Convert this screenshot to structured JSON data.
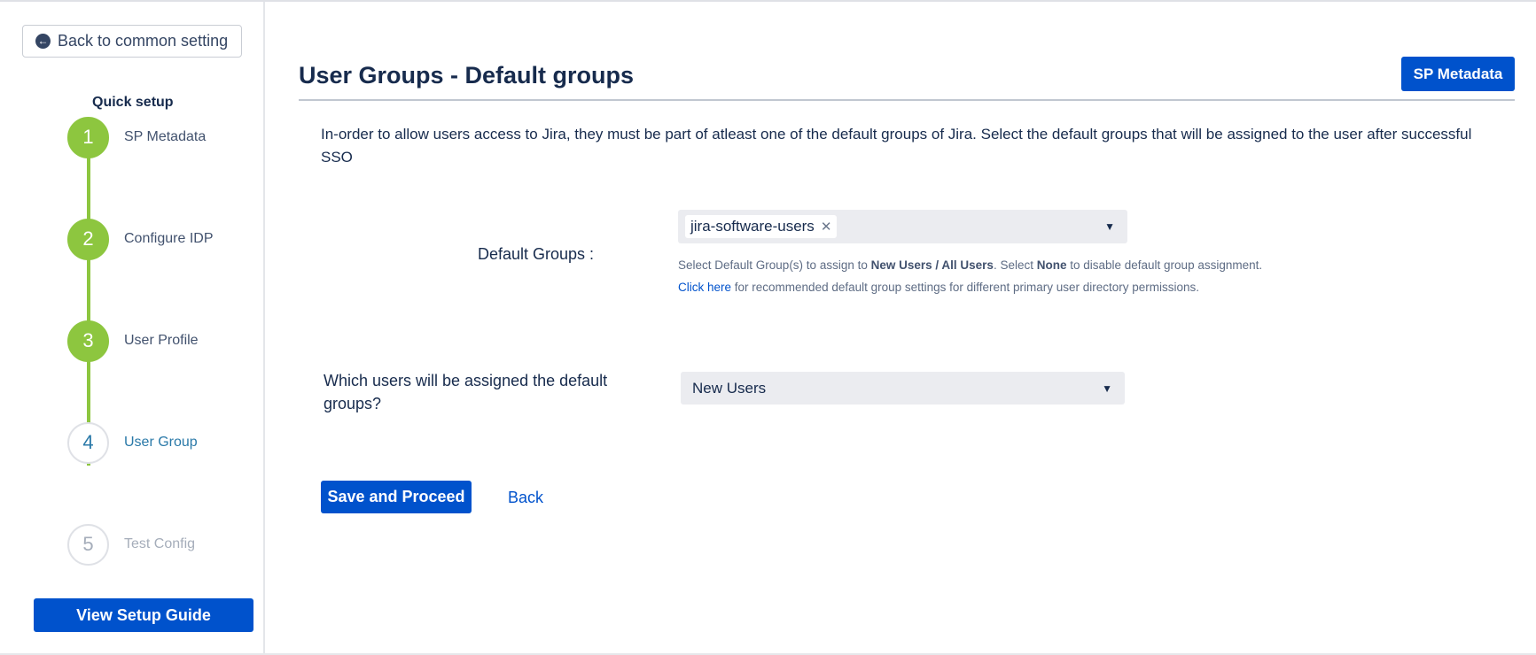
{
  "sidebar": {
    "back_button_label": "Back to common setting",
    "back_icon": "arrow-left-circle-icon",
    "quick_setup_title": "Quick setup",
    "steps": [
      {
        "number": "1",
        "label": "SP Metadata",
        "state": "done"
      },
      {
        "number": "2",
        "label": "Configure IDP",
        "state": "done"
      },
      {
        "number": "3",
        "label": "User Profile",
        "state": "done"
      },
      {
        "number": "4",
        "label": "User Group",
        "state": "active"
      },
      {
        "number": "5",
        "label": "Test Config",
        "state": "pending"
      }
    ],
    "guide_button_label": "View Setup Guide"
  },
  "header": {
    "title": "User Groups - Default groups",
    "sp_metadata_button_label": "SP Metadata"
  },
  "main": {
    "intro_text": "In-order to allow users access to Jira, they must be part of atleast one of the default groups of Jira. Select the default groups that will be assigned to the user after successful SSO",
    "default_groups": {
      "label": "Default Groups :",
      "selected_tags": [
        "jira-software-users"
      ],
      "remove_icon": "close-icon",
      "help_line1_prefix": "Select Default Group(s) to assign to ",
      "help_line1_bold1": "New Users / All Users",
      "help_line1_mid": ". Select ",
      "help_line1_bold2": "None",
      "help_line1_suffix": " to disable default group assignment.",
      "help_line2_link": "Click here",
      "help_line2_suffix": " for recommended default group settings for different primary user directory permissions."
    },
    "assign_users": {
      "label": "Which users will be assigned the default groups?",
      "selected_value": "New Users"
    },
    "save_button_label": "Save and Proceed",
    "back_link_label": "Back"
  },
  "colors": {
    "primary": "#0052cc",
    "step_done": "#8dc63f",
    "step_active": "#2a79a8"
  }
}
